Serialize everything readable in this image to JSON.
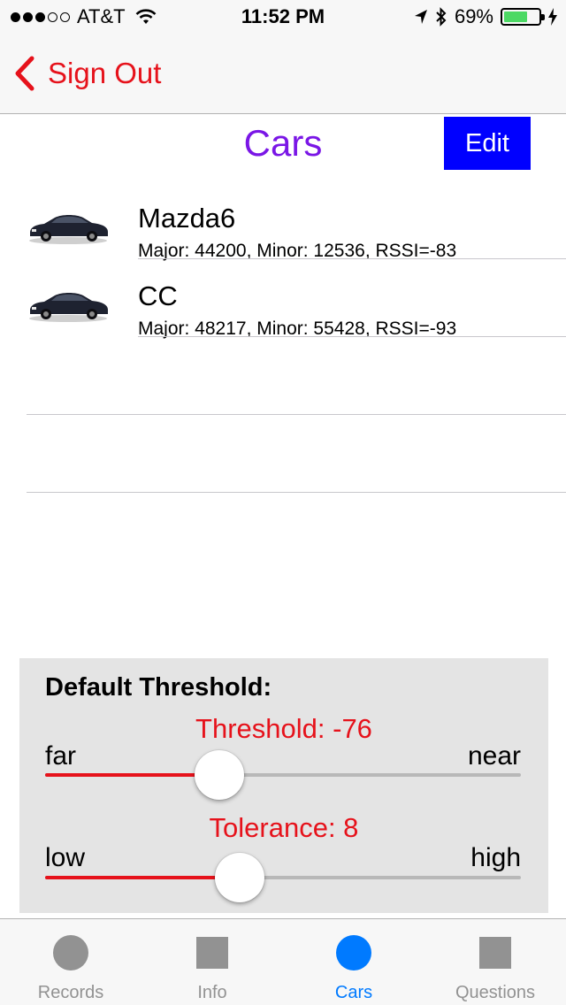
{
  "status_bar": {
    "carrier": "AT&T",
    "time": "11:52 PM",
    "battery": "69%",
    "battery_level": 0.69,
    "signal_bars": 3,
    "signal_total": 5
  },
  "nav": {
    "back_label": "Sign Out",
    "accent_color": "#e6121b"
  },
  "header": {
    "title": "Cars",
    "title_color": "#7a16e6",
    "edit_label": "Edit",
    "edit_color": "#0000ff"
  },
  "cars": [
    {
      "name": "Mazda6",
      "detail": "Major: 44200, Minor: 12536, RSSI=-83",
      "icon": "car-thumbnail"
    },
    {
      "name": "CC",
      "detail": "Major: 48217, Minor: 55428, RSSI=-93",
      "icon": "car-thumbnail"
    }
  ],
  "threshold": {
    "title": "Default Threshold:",
    "threshold_slider": {
      "value_label": "Threshold: -76",
      "min_label": "far",
      "max_label": "near",
      "position": 0.366
    },
    "tolerance_slider": {
      "value_label": "Tolerance: 8",
      "min_label": "low",
      "max_label": "high",
      "position": 0.409
    }
  },
  "tabs": [
    {
      "label": "Records",
      "icon": "circle-icon",
      "active": false
    },
    {
      "label": "Info",
      "icon": "square-icon",
      "active": false
    },
    {
      "label": "Cars",
      "icon": "circle-icon",
      "active": true
    },
    {
      "label": "Questions",
      "icon": "square-icon",
      "active": false
    }
  ],
  "colors": {
    "tab_active": "#007aff",
    "tab_inactive": "#929292",
    "panel_bg": "#e4e4e4"
  }
}
